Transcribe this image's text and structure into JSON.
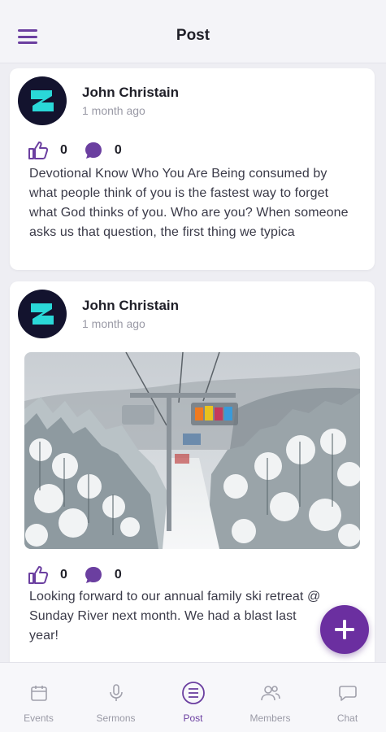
{
  "header": {
    "title": "Post"
  },
  "posts": [
    {
      "author": "John Christain",
      "time": "1 month ago",
      "likes": "0",
      "comments": "0",
      "text": "Devotional Know Who You Are Being consumed by what people think of you is the fastest way to forget what God thinks of you. Who are you? When someone asks us that question, the first thing we typica",
      "has_image": false
    },
    {
      "author": "John Christain",
      "time": "1 month ago",
      "likes": "0",
      "comments": "0",
      "text": "Looking forward to our annual family ski retreat @ Sunday River next month.  We had a blast last year!",
      "has_image": true,
      "image_description": "ski-lift-snowy-forest"
    }
  ],
  "nav": {
    "items": [
      {
        "label": "Events",
        "icon": "calendar-icon",
        "active": false
      },
      {
        "label": "Sermons",
        "icon": "microphone-icon",
        "active": false
      },
      {
        "label": "Post",
        "icon": "list-icon",
        "active": true
      },
      {
        "label": "Members",
        "icon": "members-icon",
        "active": false
      },
      {
        "label": "Chat",
        "icon": "chat-bubble-icon",
        "active": false
      }
    ]
  },
  "colors": {
    "accent": "#6b3fa0",
    "fab": "#6b2fa0",
    "background": "#eeeef3",
    "card": "#ffffff"
  }
}
